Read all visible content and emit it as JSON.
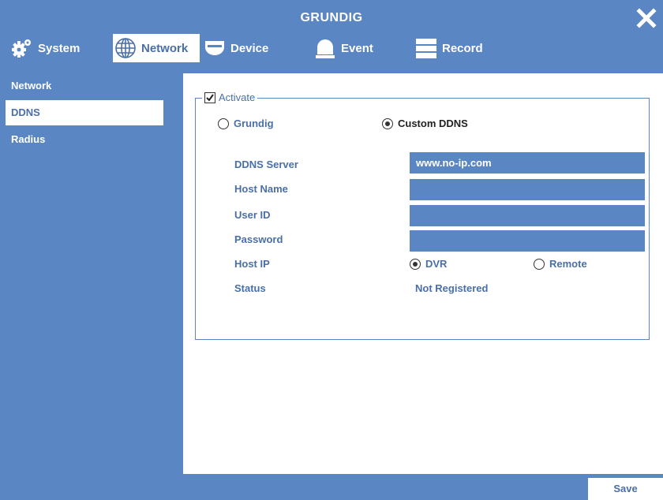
{
  "window": {
    "title": "GRUNDIG"
  },
  "tabs": [
    {
      "label": "System",
      "icon": "gear-icon"
    },
    {
      "label": "Network",
      "icon": "globe-icon",
      "active": true
    },
    {
      "label": "Device",
      "icon": "camera-icon"
    },
    {
      "label": "Event",
      "icon": "alarm-icon"
    },
    {
      "label": "Record",
      "icon": "storage-icon"
    }
  ],
  "sidebar": {
    "items": [
      {
        "label": "Network"
      },
      {
        "label": "DDNS",
        "active": true
      },
      {
        "label": "Radius"
      }
    ]
  },
  "ddns": {
    "activate_label": "Activate",
    "activate_checked": true,
    "provider_options": [
      {
        "label": "Grundig",
        "checked": false
      },
      {
        "label": "Custom DDNS",
        "checked": true
      }
    ],
    "fields": {
      "server_label": "DDNS Server",
      "server_value": "www.no-ip.com",
      "host_name_label": "Host Name",
      "host_name_value": "",
      "user_id_label": "User ID",
      "user_id_value": "",
      "password_label": "Password",
      "password_value": "",
      "host_ip_label": "Host IP",
      "host_ip_options": [
        {
          "label": "DVR",
          "checked": true
        },
        {
          "label": "Remote",
          "checked": false
        }
      ],
      "status_label": "Status",
      "status_value": "Not Registered"
    }
  },
  "footer": {
    "save_label": "Save"
  },
  "colors": {
    "accent": "#5b86c4",
    "text": "#4a6fa8",
    "panel": "#ffffff"
  }
}
